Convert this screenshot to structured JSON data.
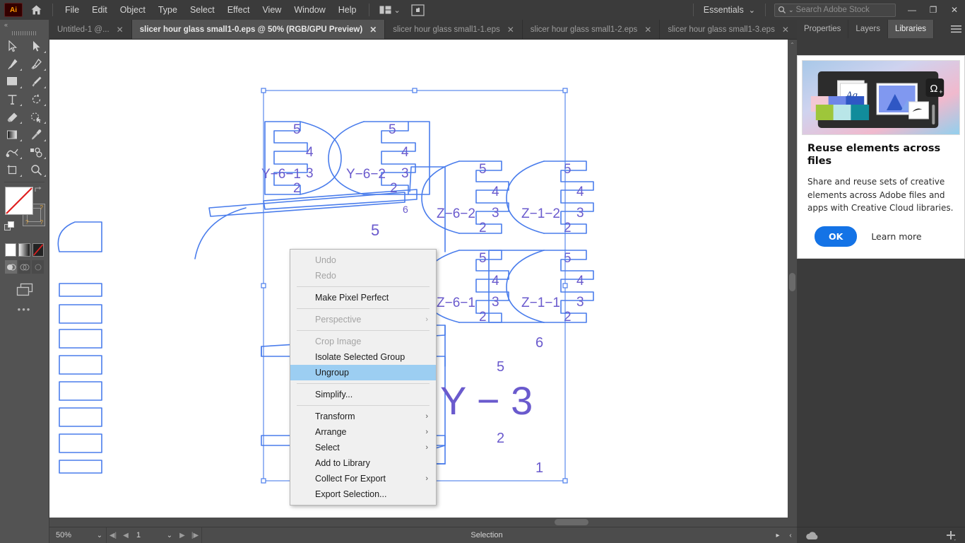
{
  "app": {
    "logo_text": "Ai",
    "home_icon": "home-icon",
    "screen_mode_icon": "screen-mode-icon"
  },
  "menubar": {
    "items": [
      "File",
      "Edit",
      "Object",
      "Type",
      "Select",
      "Effect",
      "View",
      "Window",
      "Help"
    ],
    "arrange_icon": "arrange-documents-icon",
    "arrange_caret": "⌄",
    "workspace": "Essentials",
    "workspace_caret": "⌄",
    "search": {
      "placeholder": "Search Adobe Stock",
      "icon": "search-icon",
      "caret": "⌄"
    },
    "window_controls": {
      "minimize": "—",
      "restore": "❐",
      "close": "✕"
    }
  },
  "tabs": [
    {
      "label": "Untitled-1 @...",
      "close": "✕",
      "active": false
    },
    {
      "label": "slicer hour glass small1-0.eps @ 50% (RGB/GPU Preview)",
      "close": "✕",
      "active": true
    },
    {
      "label": "slicer hour glass small1-1.eps",
      "close": "✕",
      "active": false
    },
    {
      "label": "slicer hour glass small1-2.eps",
      "close": "✕",
      "active": false
    },
    {
      "label": "slicer hour glass small1-3.eps",
      "close": "✕",
      "active": false
    }
  ],
  "tab_overflow": "»",
  "toolbar": {
    "collapse": "«",
    "tools": [
      {
        "name": "selection-tool",
        "glyph": "selection"
      },
      {
        "name": "direct-selection-tool",
        "glyph": "direct-selection"
      },
      {
        "name": "pen-tool",
        "glyph": "pen"
      },
      {
        "name": "curvature-tool",
        "glyph": "curvature"
      },
      {
        "name": "rectangle-tool",
        "glyph": "rectangle"
      },
      {
        "name": "paintbrush-tool",
        "glyph": "brush"
      },
      {
        "name": "type-tool",
        "glyph": "type"
      },
      {
        "name": "rotate-tool",
        "glyph": "rotate"
      },
      {
        "name": "eraser-tool",
        "glyph": "eraser"
      },
      {
        "name": "shape-builder-tool",
        "glyph": "shape-builder"
      },
      {
        "name": "gradient-tool",
        "glyph": "gradient"
      },
      {
        "name": "eyedropper-tool",
        "glyph": "eyedropper"
      },
      {
        "name": "blend-tool",
        "glyph": "blend"
      },
      {
        "name": "symbol-sprayer-tool",
        "glyph": "symbol-sprayer"
      },
      {
        "name": "artboard-tool",
        "glyph": "artboard"
      },
      {
        "name": "zoom-tool",
        "glyph": "zoom"
      }
    ],
    "fill_stroke": {
      "fill_name": "fill-swatch",
      "stroke_name": "stroke-swatch",
      "swap_icon": "swap-fill-stroke-icon",
      "default_icon": "default-fill-stroke-icon",
      "question_marks": [
        "?",
        "?",
        "?"
      ]
    },
    "fill_modes": [
      "color-swatch",
      "gradient-swatch",
      "none-swatch"
    ],
    "draw_modes": [
      "draw-normal",
      "draw-behind",
      "draw-inside"
    ],
    "screen_mode_icon": "change-screen-mode-icon",
    "more_tools": "•••"
  },
  "mini_panel": {
    "expand": "▸▸",
    "close": "✕",
    "buttons": [
      "hamburger-icon",
      "overlap-circles-icon"
    ]
  },
  "context_menu": {
    "items": [
      {
        "label": "Undo",
        "disabled": true,
        "highlighted": false,
        "submenu": false
      },
      {
        "label": "Redo",
        "disabled": true,
        "highlighted": false,
        "submenu": false
      },
      {
        "separator": true
      },
      {
        "label": "Make Pixel Perfect",
        "disabled": false,
        "highlighted": false,
        "submenu": false
      },
      {
        "separator": true
      },
      {
        "label": "Perspective",
        "disabled": true,
        "highlighted": false,
        "submenu": true
      },
      {
        "separator": true
      },
      {
        "label": "Crop Image",
        "disabled": true,
        "highlighted": false,
        "submenu": false
      },
      {
        "label": "Isolate Selected Group",
        "disabled": false,
        "highlighted": false,
        "submenu": false
      },
      {
        "label": "Ungroup",
        "disabled": false,
        "highlighted": true,
        "submenu": false
      },
      {
        "separator": true
      },
      {
        "label": "Simplify...",
        "disabled": false,
        "highlighted": false,
        "submenu": false
      },
      {
        "separator": true
      },
      {
        "label": "Transform",
        "disabled": false,
        "highlighted": false,
        "submenu": true
      },
      {
        "label": "Arrange",
        "disabled": false,
        "highlighted": false,
        "submenu": true
      },
      {
        "label": "Select",
        "disabled": false,
        "highlighted": false,
        "submenu": true
      },
      {
        "label": "Add to Library",
        "disabled": false,
        "highlighted": false,
        "submenu": false
      },
      {
        "label": "Collect For Export",
        "disabled": false,
        "highlighted": false,
        "submenu": true
      },
      {
        "label": "Export Selection...",
        "disabled": false,
        "highlighted": false,
        "submenu": false
      }
    ],
    "submenu_arrow": "›",
    "highlight_color": "#9ccef2"
  },
  "right_panel": {
    "tabs": [
      {
        "label": "Properties",
        "active": false
      },
      {
        "label": "Layers",
        "active": false
      },
      {
        "label": "Libraries",
        "active": true
      }
    ],
    "menu_icon": "panel-menu-icon",
    "card": {
      "art_icon": "libraries-promo-illustration",
      "art_label": "Ag",
      "title": "Reuse elements across files",
      "body": "Share and reuse sets of creative elements across Adobe files and apps with Creative Cloud libraries.",
      "ok_label": "OK",
      "learn_label": "Learn more",
      "accent_color": "#1473e6"
    },
    "footer": {
      "cloud_icon": "cloud-icon",
      "add_icon": "add-icon"
    }
  },
  "statusbar": {
    "zoom_level": "50%",
    "zoom_caret": "⌄",
    "first_page_icon": "first-page-icon",
    "prev_page_icon": "prev-page-icon",
    "page_number": "1",
    "page_caret": "⌄",
    "next_page_icon": "next-page-icon",
    "last_page_icon": "last-page-icon",
    "status_text": "Selection",
    "status_caret": "▸",
    "expand_caret": "‹"
  },
  "artwork": {
    "description": "Vector laser-cut slicer template of an hour glass, blue strokes on white artboard, with selection bounding box and handles",
    "stroke_color": "#4a7dec",
    "label_color": "#6a5acd",
    "labels": [
      "Y-6-1",
      "Y-6-2",
      "Z-6-2",
      "Z-1-2",
      "Z-6-1",
      "Z-1-1",
      "Y-3",
      "5",
      "4",
      "3",
      "2",
      "6",
      "1"
    ]
  }
}
